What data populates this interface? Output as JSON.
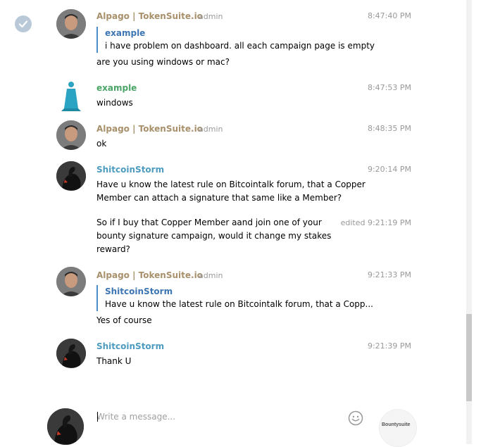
{
  "messages": [
    {
      "name": "Alpago | TokenSuite.io",
      "badge": "admin",
      "time": "8:47:40 PM",
      "quote": {
        "name": "example",
        "text": "i have problem on dashboard. all each campaign page is empty"
      },
      "text": "are you using windows or mac?"
    },
    {
      "name": "example",
      "time": "8:47:53 PM",
      "text": "windows"
    },
    {
      "name": "Alpago | TokenSuite.io",
      "badge": "admin",
      "time": "8:48:35 PM",
      "text": "ok"
    },
    {
      "name": "ShitcoinStorm",
      "time": "9:20:14 PM",
      "lines": [
        "Have u know the latest rule on Bitcointalk forum, that a Copper",
        "Member can attach a signature that same like a Member?"
      ]
    },
    {
      "time": "edited 9:21:19 PM",
      "lines": [
        "So if I buy that Copper Member aand join one of your",
        "bounty signature campaign, would it change my stakes",
        "reward?"
      ]
    },
    {
      "name": "Alpago | TokenSuite.io",
      "badge": "admin",
      "time": "9:21:33 PM",
      "quote": {
        "name": "ShitcoinStorm",
        "text": "Have u know the latest rule on Bitcointalk forum, that a Copp..."
      },
      "text": "Yes of course"
    },
    {
      "name": "ShitcoinStorm",
      "time": "9:21:39 PM",
      "text": "Thank U"
    }
  ],
  "composer": {
    "placeholder": "Write a message...",
    "send_logo": "Bountysuite"
  },
  "colors": {
    "admin_name": "#a8906b",
    "example_name": "#4aa567",
    "storm_name": "#4d9bbf",
    "quote_bar": "#4d8bc9"
  }
}
